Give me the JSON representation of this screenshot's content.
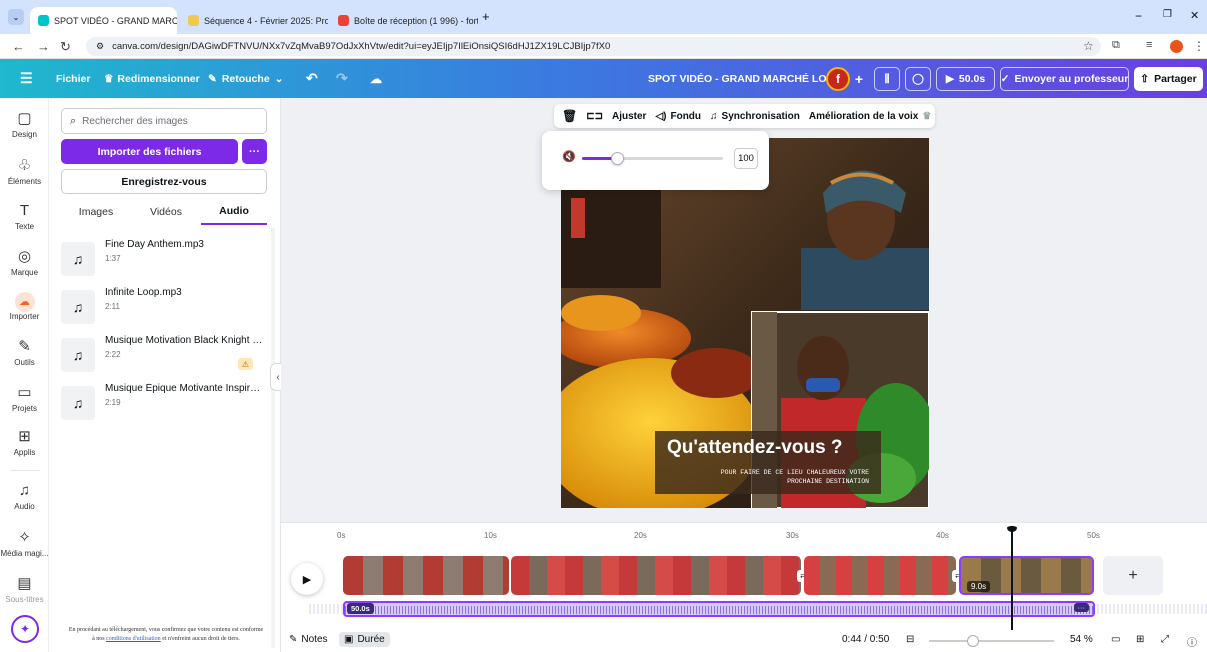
{
  "browser": {
    "tabs": [
      {
        "label": "SPOT VIDÉO - GRAND MARCHÉ",
        "color": "#00c4cc"
      },
      {
        "label": "Séquence 4 - Février 2025: Proc",
        "color": "#f2c94c"
      },
      {
        "label": "Boîte de réception (1 996) - forti",
        "color": "#ea4335"
      }
    ],
    "url": "canva.com/design/DAGiwDFTNVU/NXx7vZqMvaB97OdJxXhVtw/edit?ui=eyJEIjp7IlEiOnsiQSI6dHJ1ZX19LCJBIjp7fX0"
  },
  "header": {
    "file": "Fichier",
    "resize": "Redimensionner",
    "retouch": "Retouche",
    "doc_title": "SPOT VIDÉO - GRAND MARCHÉ LOMÉ",
    "avatar_letter": "f",
    "duration": "50.0s",
    "send": "Envoyer au professeur",
    "share": "Partager"
  },
  "rail": [
    {
      "label": "Design",
      "icon": "▢"
    },
    {
      "label": "Éléments",
      "icon": "♧"
    },
    {
      "label": "Texte",
      "icon": "T"
    },
    {
      "label": "Marque",
      "icon": "◎"
    },
    {
      "label": "Importer",
      "icon": "☁"
    },
    {
      "label": "Outils",
      "icon": "✎"
    },
    {
      "label": "Projets",
      "icon": "▭"
    },
    {
      "label": "Applis",
      "icon": "⊞"
    },
    {
      "label": "Audio",
      "icon": "♫"
    },
    {
      "label": "Média magi...",
      "icon": "✧"
    },
    {
      "label": "Sous-titres",
      "icon": "▤"
    }
  ],
  "panel": {
    "search_placeholder": "Rechercher des images",
    "import_label": "Importer des fichiers",
    "more": "···",
    "record_label": "Enregistrez-vous",
    "tabs": [
      "Images",
      "Vidéos",
      "Audio"
    ],
    "tracks": [
      {
        "name": "Fine Day Anthem.mp3",
        "duration": "1:37",
        "warning": false
      },
      {
        "name": "Infinite Loop.mp3",
        "duration": "2:11",
        "warning": false
      },
      {
        "name": "Musique Motivation Black Knight - ...",
        "duration": "2:22",
        "warning": true
      },
      {
        "name": "Musique Épique Motivante Inspira...",
        "duration": "2:19",
        "warning": false
      }
    ],
    "terms_1": "En procédant au téléchargement, vous confirmez que votre contenu est conforme",
    "terms_2": "à nos",
    "terms_link": "conditions d'utilisation",
    "terms_3": "et n'enfreint aucun droit de tiers."
  },
  "toolbar": {
    "adjust": "Ajuster",
    "fade": "Fondu",
    "sync": "Synchronisation",
    "voice": "Amélioration de la voix"
  },
  "volume": {
    "value": "100",
    "level": 0.25
  },
  "canvas": {
    "headline": "Qu'attendez-vous ?",
    "subline_1": "POUR FAIRE DE CE LIEU CHALEUREUX VOTRE",
    "subline_2": "PROCHAINE DESTINATION"
  },
  "timeline": {
    "ticks": [
      "0s",
      "10s",
      "20s",
      "30s",
      "40s",
      "50s"
    ],
    "clip_badge": "9.0s",
    "audio_badge": "50.0s",
    "audio_more": "···",
    "add": "+"
  },
  "footer": {
    "notes": "Notes",
    "duration_label": "Durée",
    "time": "0:44 / 0:50",
    "zoom": "54 %",
    "zoom_level": 0.35
  }
}
